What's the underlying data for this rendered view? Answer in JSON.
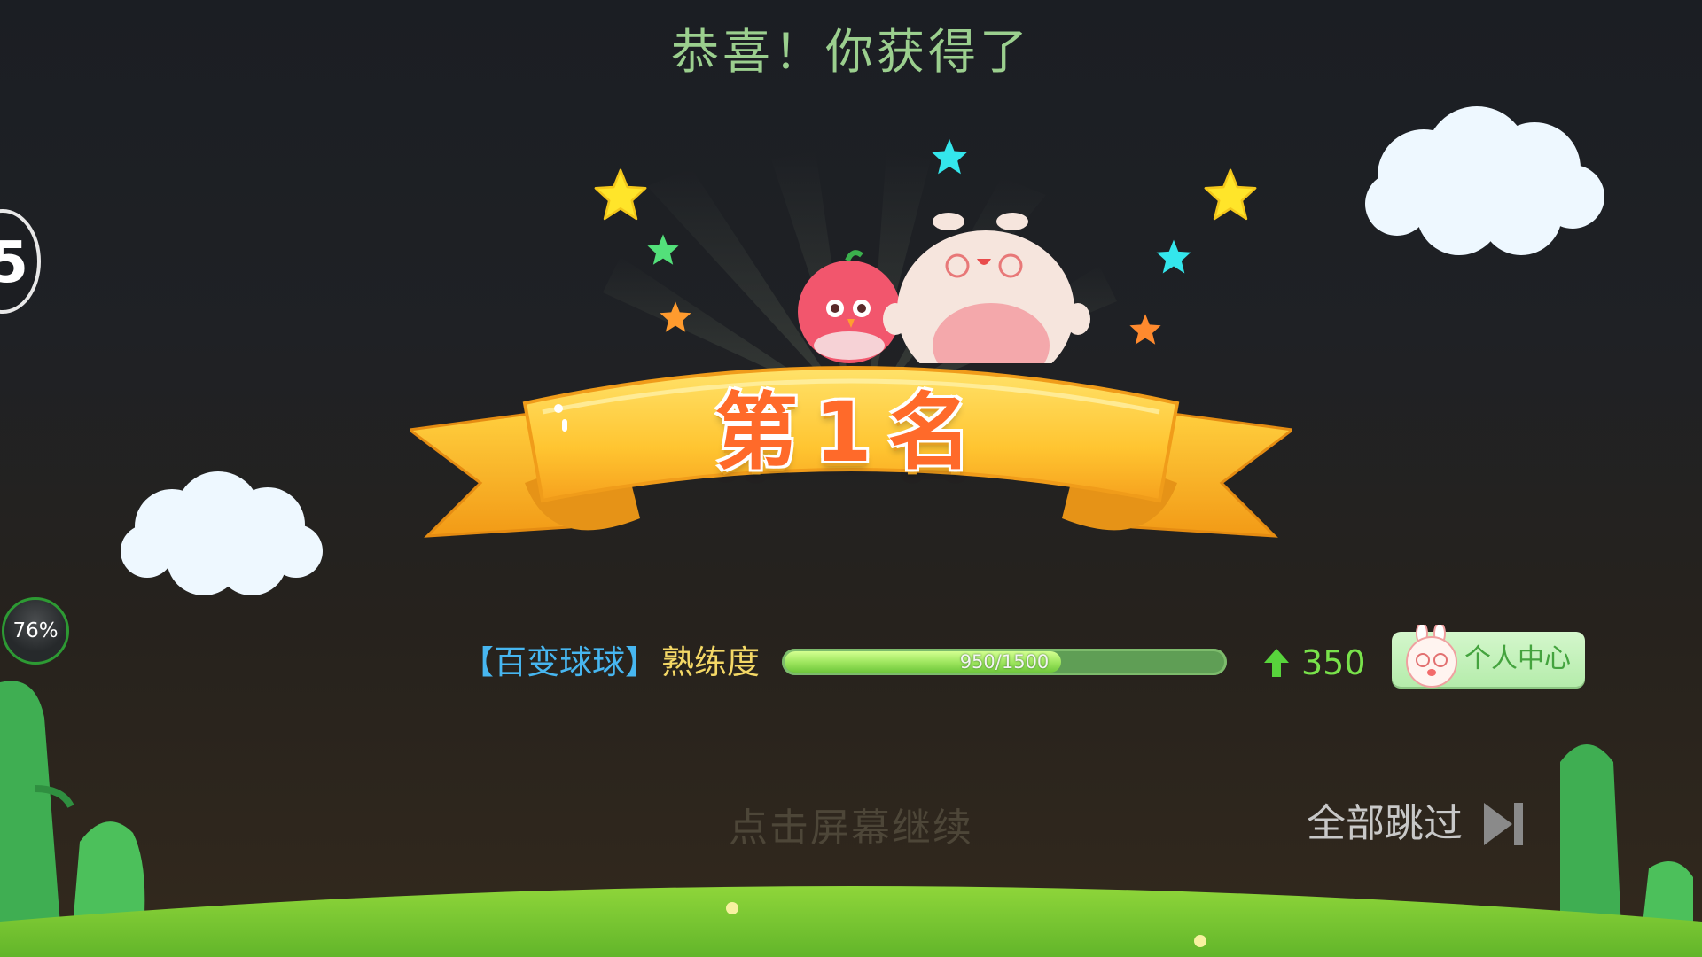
{
  "header": {
    "title": "恭喜！你获得了"
  },
  "award": {
    "rank_label": "第1名"
  },
  "proficiency": {
    "game_name": "【百变球球】",
    "label": "熟练度",
    "progress_text": "950/1500",
    "current": 950,
    "max": 1500,
    "progress_fraction": 0.633,
    "gain": "350"
  },
  "profile_button": {
    "label": "个人中心"
  },
  "footer": {
    "tap_continue": "点击屏幕继续",
    "skip_all": "全部跳过"
  },
  "left_widgets": {
    "edge_badge_text": "5",
    "percent_text": "76%"
  },
  "colors": {
    "title": "#9bcf8e",
    "game_name": "#47b6f0",
    "label": "#f4d866",
    "gain": "#79e24b",
    "ribbon": "#f6b92c",
    "rank_text": "#ff6a2a"
  },
  "icons": {
    "up": "up-arrow-icon",
    "skip": "skip-forward-icon",
    "profile": "bunny-avatar-icon"
  }
}
